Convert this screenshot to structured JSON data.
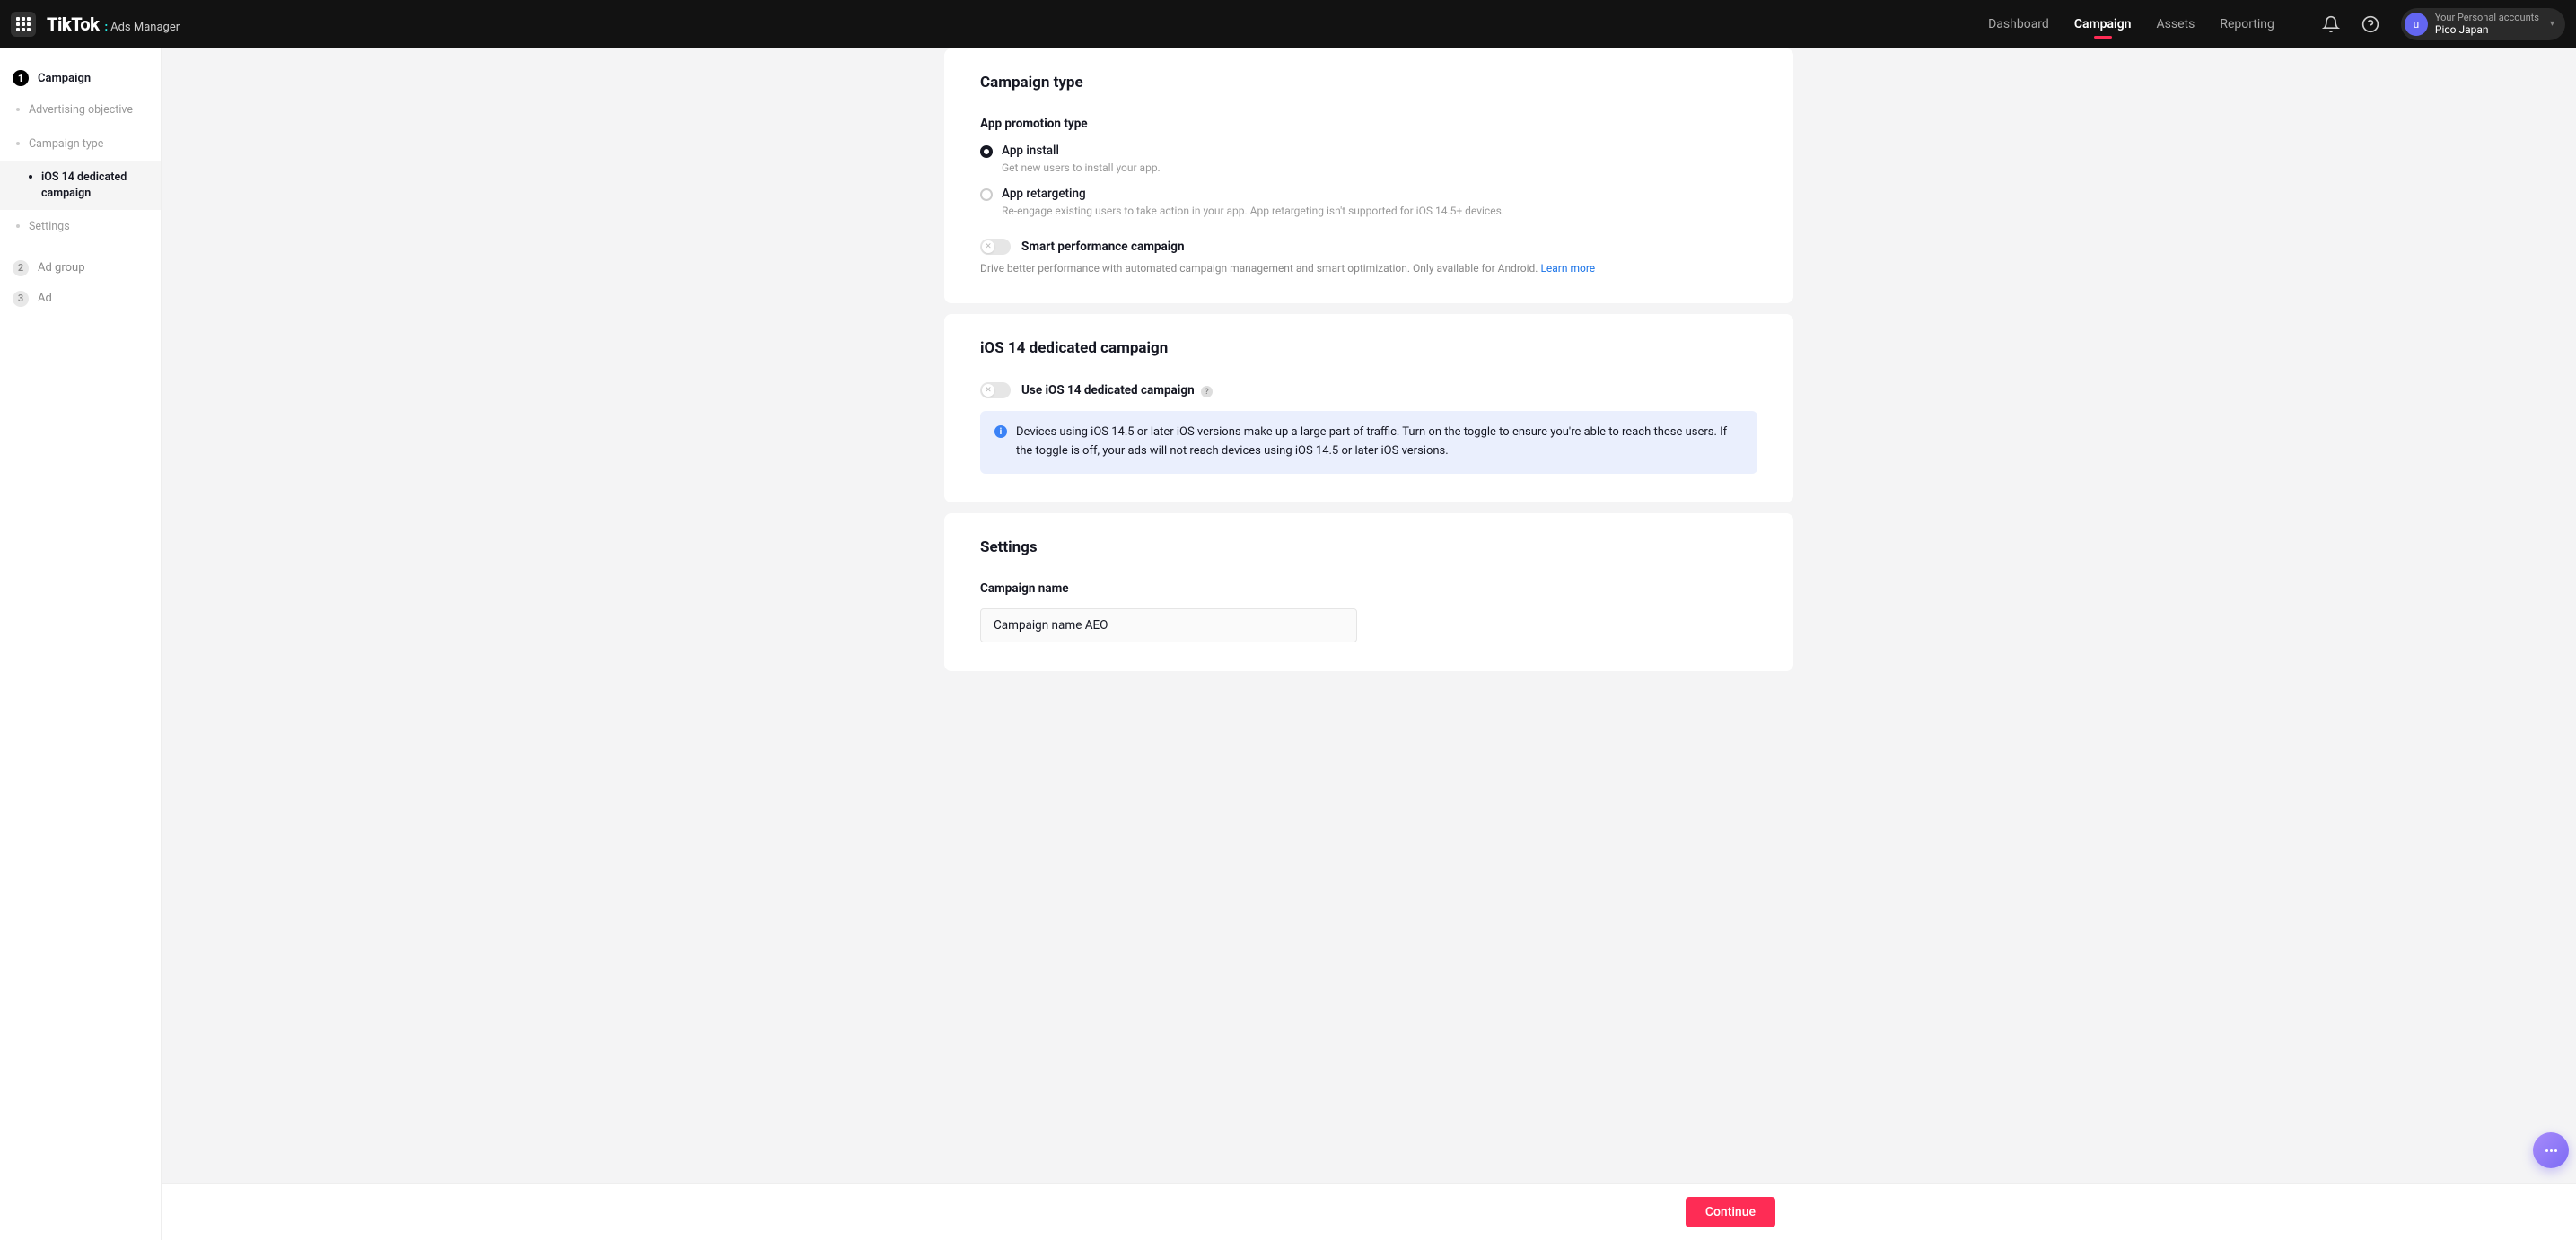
{
  "header": {
    "logo": "TikTok",
    "logo_sub": "Ads Manager",
    "nav": {
      "dashboard": "Dashboard",
      "campaign": "Campaign",
      "assets": "Assets",
      "reporting": "Reporting"
    },
    "account": {
      "initial": "u",
      "line1": "Your Personal accounts",
      "line2": "Pico Japan"
    }
  },
  "sidebar": {
    "step1": {
      "num": "1",
      "label": "Campaign"
    },
    "step1_items": {
      "objective": "Advertising objective",
      "type": "Campaign type",
      "ios14": "iOS 14 dedicated campaign",
      "settings": "Settings"
    },
    "step2": {
      "num": "2",
      "label": "Ad group"
    },
    "step3": {
      "num": "3",
      "label": "Ad"
    }
  },
  "campaign_type": {
    "title": "Campaign type",
    "field_label": "App promotion type",
    "install": {
      "label": "App install",
      "desc": "Get new users to install your app."
    },
    "retarget": {
      "label": "App retargeting",
      "desc": "Re-engage existing users to take action in your app. App retargeting isn't supported for iOS 14.5+ devices."
    },
    "smart": {
      "label": "Smart performance campaign",
      "desc": "Drive better performance with automated campaign management and smart optimization. Only available for Android. ",
      "link": "Learn more"
    }
  },
  "ios14": {
    "title": "iOS 14 dedicated campaign",
    "toggle_label": "Use iOS 14 dedicated campaign",
    "info": "Devices using iOS 14.5 or later iOS versions make up a large part of traffic. Turn on the toggle to ensure you're able to reach these users. If the toggle is off, your ads will not reach devices using iOS 14.5 or later iOS versions."
  },
  "settings": {
    "title": "Settings",
    "name_label": "Campaign name",
    "name_value": "Campaign name AEO"
  },
  "footer": {
    "continue": "Continue"
  }
}
